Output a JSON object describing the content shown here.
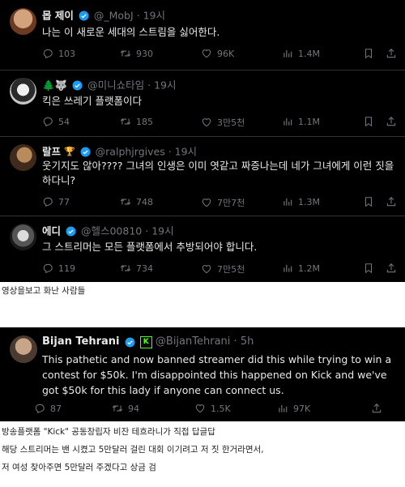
{
  "tweets1": [
    {
      "name": "몹 제이",
      "handle": "@_MobJ",
      "time": "19시",
      "text": "나는 이 새로운 세대의 스트림을 싫어한다.",
      "reply": "103",
      "retweet": "930",
      "like": "96K",
      "views": "1.4M"
    },
    {
      "name": "🌲🐺",
      "handle": "@미니쇼타임",
      "time": "19시",
      "text": "킥은 쓰레기 플랫폼이다",
      "reply": "54",
      "retweet": "185",
      "like": "3만5천",
      "views": "1.1M"
    },
    {
      "name": "랄프",
      "handle": "@ralphjrgives",
      "time": "19시",
      "text": "웃기지도 않아???? 그녀의 인생은 이미 엿같고 짜증나는데 네가 그녀에게 이런 짓을 하다니?",
      "reply": "77",
      "retweet": "748",
      "like": "7만7천",
      "views": "1.3M"
    },
    {
      "name": "에디",
      "handle": "@헬스00810",
      "time": "19시",
      "text": "그 스트리머는 모든 플랫폼에서 추방되어야 합니다.",
      "reply": "119",
      "retweet": "734",
      "like": "7만5천",
      "views": "1.2M"
    }
  ],
  "caption1": "영상을보고 화난 사람들",
  "tweet2": {
    "name": "Bijan Tehrani",
    "handle": "@BijanTehrani",
    "time": "5h",
    "text": "This pathetic and now banned streamer did this while trying to win a contest for $50k. I'm disappointed this happened on Kick and we've got $50k for this lady if anyone can connect us.",
    "reply": "87",
    "retweet": "94",
    "like": "1.5K",
    "views": "97K"
  },
  "caption2": [
    "방송플랫폼 \"Kick\" 공동창립자 비잔 테흐라니가 직접 답글답",
    "해당 스트리머는 밴 시켰고 5만달러 걸린 대회 이기려고 저 짓 한거라면서,",
    "저 여성 찾아주면 5만달러 주겠다고 상금 검"
  ],
  "colors": {
    "bg": "#000000",
    "text": "#e7e9ea",
    "muted": "#71767b",
    "verified": "#1d9bf0",
    "kick": "#53fc18"
  }
}
